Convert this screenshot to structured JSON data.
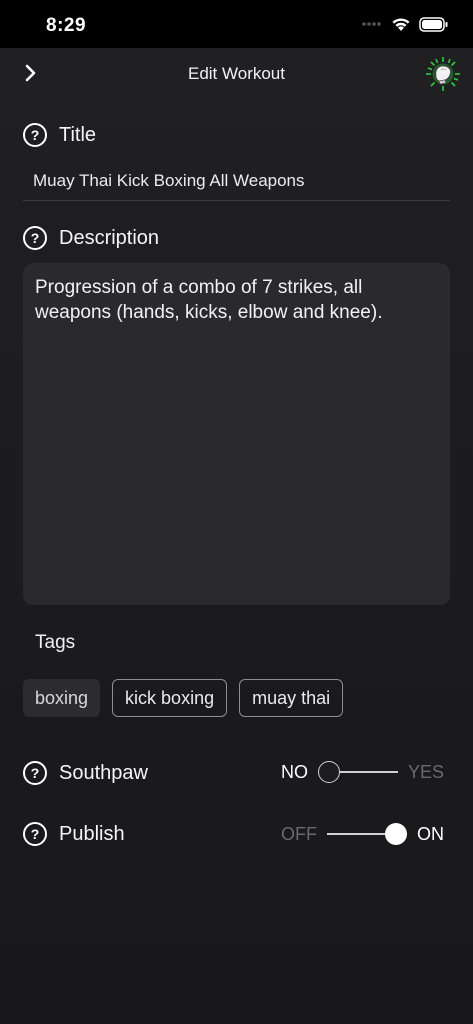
{
  "status_bar": {
    "time": "8:29"
  },
  "nav": {
    "title": "Edit Workout",
    "back_icon": "chevron-right-icon",
    "right_icon": "boxing-glove-icon"
  },
  "title_section": {
    "label": "Title",
    "value": "Muay Thai Kick Boxing All Weapons"
  },
  "description_section": {
    "label": "Description",
    "value": "Progression of a combo of 7 strikes, all weapons (hands, kicks, elbow and knee)."
  },
  "tags_section": {
    "label": "Tags",
    "items": [
      {
        "label": "boxing",
        "style": "filled"
      },
      {
        "label": "kick boxing",
        "style": "outline"
      },
      {
        "label": "muay thai",
        "style": "outline"
      }
    ]
  },
  "southpaw": {
    "label": "Southpaw",
    "off_label": "NO",
    "on_label": "YES",
    "value": false
  },
  "publish": {
    "label": "Publish",
    "off_label": "OFF",
    "on_label": "ON",
    "value": true
  },
  "help_glyph": "?"
}
